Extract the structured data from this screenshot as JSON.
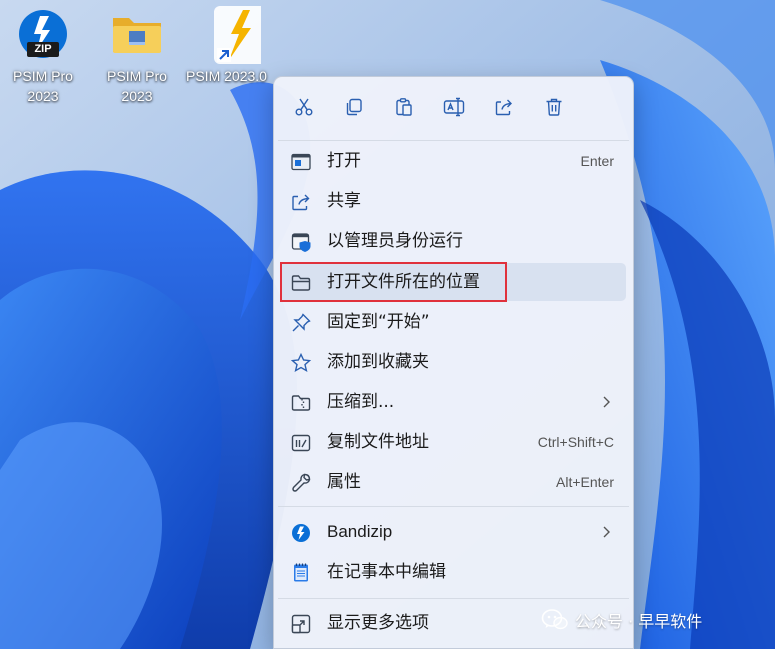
{
  "desktop": {
    "icons": [
      {
        "label": "PSIM Pro\n2023",
        "icon": "zip-archive-icon",
        "badge_text": "ZIP",
        "accent": "#0a6fd6"
      },
      {
        "label": "PSIM Pro\n2023",
        "icon": "folder-icon",
        "accent": "#f3c94e"
      },
      {
        "label": "PSIM 2023.0",
        "icon": "psim-app-shortcut-icon",
        "accent": "#f5b400"
      }
    ]
  },
  "context_menu": {
    "toolbar": [
      {
        "icon": "scissors-icon",
        "action": "cut"
      },
      {
        "icon": "copy-icon",
        "action": "copy"
      },
      {
        "icon": "paste-icon",
        "action": "paste"
      },
      {
        "icon": "rename-icon",
        "action": "rename"
      },
      {
        "icon": "share-icon",
        "action": "share"
      },
      {
        "icon": "trash-icon",
        "action": "delete"
      }
    ],
    "items": [
      {
        "label": "打开",
        "shortcut": "Enter",
        "icon": "open-window-icon"
      },
      {
        "label": "共享",
        "shortcut": "",
        "icon": "share-icon"
      },
      {
        "label": "以管理员身份运行",
        "shortcut": "",
        "icon": "shield-admin-icon"
      },
      {
        "label": "打开文件所在的位置",
        "shortcut": "",
        "icon": "folder-outline-icon",
        "highlighted": true
      },
      {
        "label": "固定到“开始”",
        "shortcut": "",
        "icon": "pin-icon"
      },
      {
        "label": "添加到收藏夹",
        "shortcut": "",
        "icon": "star-icon"
      },
      {
        "label": "压缩到...",
        "shortcut": "",
        "icon": "zip-folder-icon",
        "submenu": true
      },
      {
        "label": "复制文件地址",
        "shortcut": "Ctrl+Shift+C",
        "icon": "copy-path-icon"
      },
      {
        "label": "属性",
        "shortcut": "Alt+Enter",
        "icon": "wrench-icon"
      },
      {
        "label": "Bandizip",
        "shortcut": "",
        "icon": "bandizip-icon",
        "submenu": true
      },
      {
        "label": "在记事本中编辑",
        "shortcut": "",
        "icon": "notepad-icon"
      },
      {
        "label": "显示更多选项",
        "shortcut": "",
        "icon": "more-options-icon"
      }
    ],
    "accent": "#0067c0",
    "highlight_color": "#e0313c"
  },
  "watermark": {
    "text": "公众号 · 早早软件",
    "icon": "wechat-icon"
  }
}
